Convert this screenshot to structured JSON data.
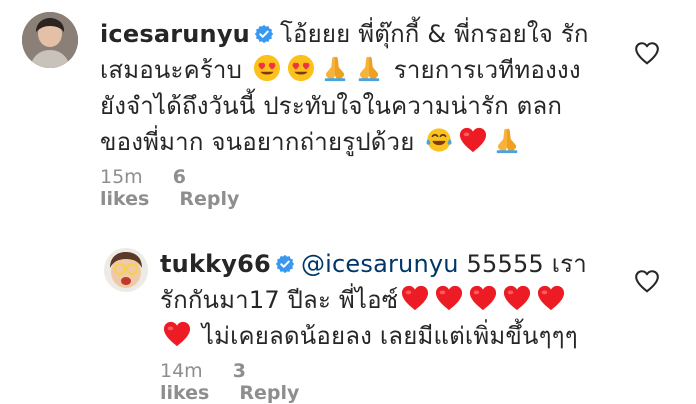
{
  "comments": [
    {
      "username": "icesarunyu",
      "line1": "โอ้ยยย พี่ตุ๊กกี้ & พี่กรอยใจ รัก",
      "line2_text": "เสมอนะคร้าบ",
      "line2_after": "รายการเวทีทองงง",
      "line3": "ยังจำได้ถึงวันนี้ ประทับใจในความน่ารัก ตลก",
      "line4": "ของพี่มาก จนอยากถ่ายรูปด้วย",
      "time": "15m",
      "likes": "6 likes",
      "reply": "Reply"
    },
    {
      "username": "tukky66",
      "mention": "@icesarunyu",
      "line1_after": "55555 เรา",
      "line2": "รักกันมา17 ปีละ พี่ไอซ์",
      "line3": "ไม่เคยลดน้อยลง เลยมีแต่เพิ่มขึ้นๆๆๆ",
      "time": "14m",
      "likes": "3 likes",
      "reply": "Reply"
    }
  ],
  "colors": {
    "text": "#262626",
    "meta": "#8e8e8e",
    "verified": "#3897f0",
    "mention": "#00376b",
    "heart_red": "#ed1c24"
  },
  "icons": [
    "verified-badge-icon",
    "heart-eyes-emoji",
    "folded-hands-emoji",
    "tears-of-joy-emoji",
    "red-heart-emoji",
    "like-heart-outline-icon"
  ]
}
